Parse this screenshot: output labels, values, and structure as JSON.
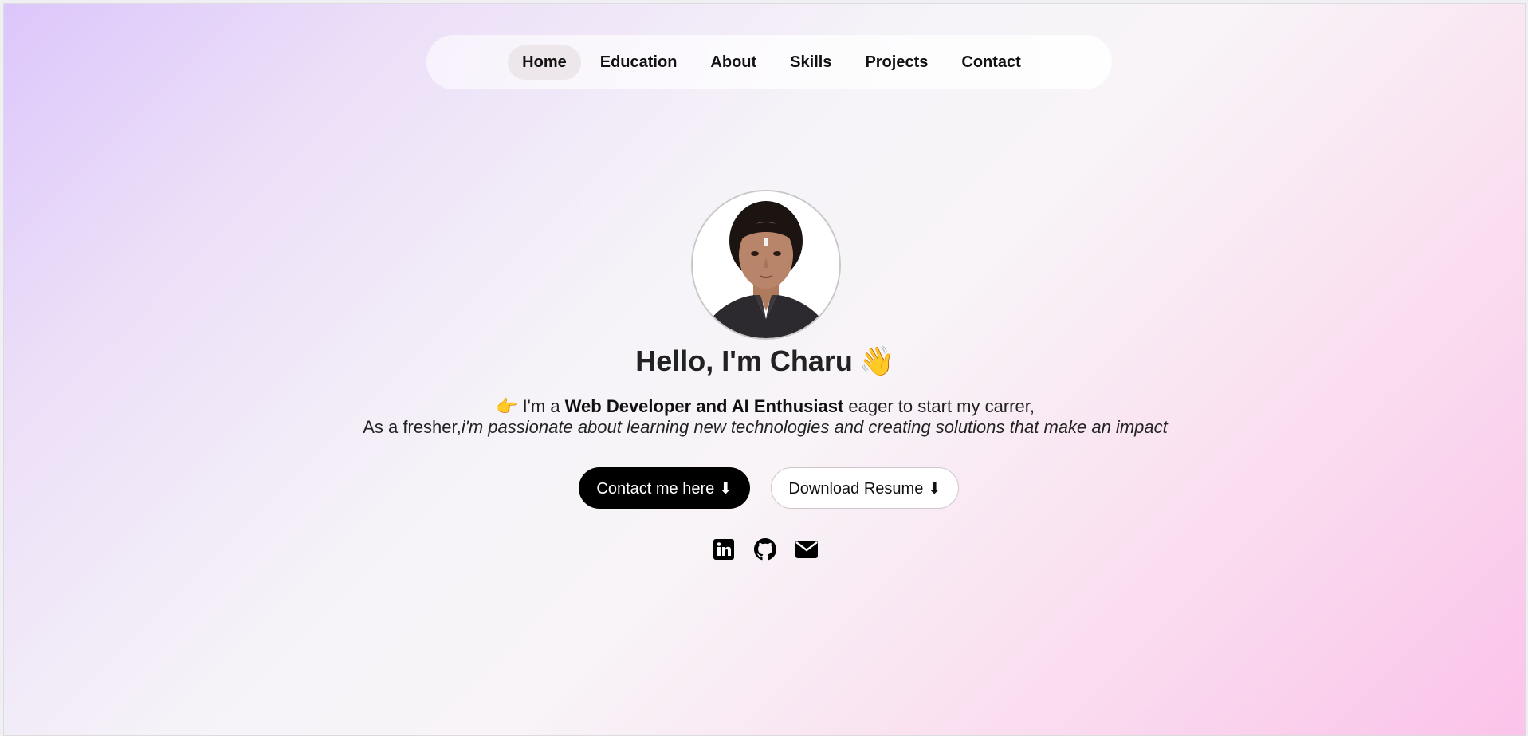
{
  "nav": {
    "items": [
      {
        "label": "Home",
        "active": true
      },
      {
        "label": "Education",
        "active": false
      },
      {
        "label": "About",
        "active": false
      },
      {
        "label": "Skills",
        "active": false
      },
      {
        "label": "Projects",
        "active": false
      },
      {
        "label": "Contact",
        "active": false
      }
    ]
  },
  "hero": {
    "title": "Hello, I'm Charu",
    "title_emoji": "👋",
    "intro_line1_prefix_emoji": "👉",
    "intro_line1_pre": "I'm a ",
    "intro_line1_bold": "Web Developer and AI Enthusiast",
    "intro_line1_post": " eager to start my carrer,",
    "intro_line2_pre": "As a fresher,",
    "intro_line2_italic": "i'm passionate about learning new technologies and creating solutions that make an impact"
  },
  "buttons": {
    "contact": "Contact me here ⬇",
    "resume": "Download Resume ⬇"
  },
  "socials": [
    "linkedin-icon",
    "github-icon",
    "email-icon"
  ],
  "colors": {
    "gradient_start": "#dcc6fb",
    "gradient_end": "#fbc3ea",
    "primary_button": "#000000"
  }
}
